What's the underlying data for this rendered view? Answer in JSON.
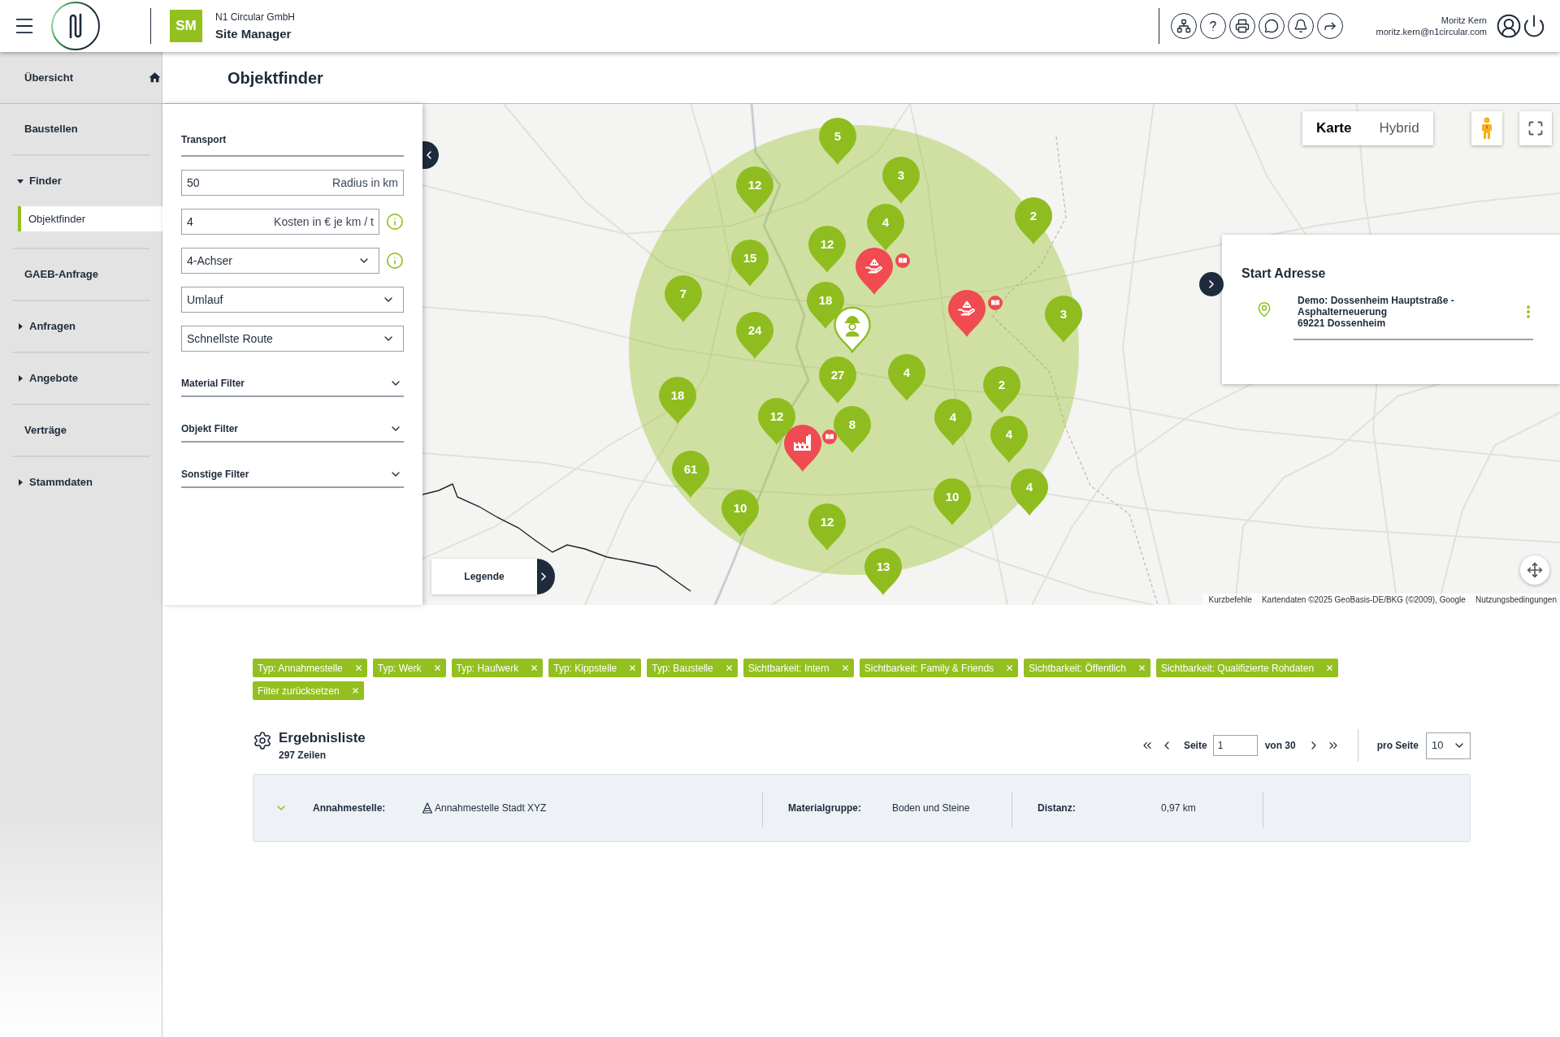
{
  "header": {
    "company": "N1 Circular GmbH",
    "app_name": "Site Manager",
    "app_initials": "SM",
    "user_name": "Moritz Kern",
    "user_email": "moritz.kern@n1circular.com"
  },
  "page_title": "Objektfinder",
  "sidebar": {
    "items": [
      {
        "kind": "home",
        "label": "Übersicht",
        "selected": false
      },
      {
        "kind": "link",
        "label": "Baustellen",
        "selected": false
      },
      {
        "kind": "group",
        "label": "Finder",
        "selected": false,
        "expanded": true,
        "children": [
          {
            "label": "Objektfinder",
            "selected": true
          }
        ]
      },
      {
        "kind": "link",
        "label": "GAEB-Anfrage",
        "selected": false
      },
      {
        "kind": "group",
        "label": "Anfragen",
        "selected": false,
        "expanded": false
      },
      {
        "kind": "group",
        "label": "Angebote",
        "selected": false,
        "expanded": false
      },
      {
        "kind": "link",
        "label": "Verträge",
        "selected": false
      },
      {
        "kind": "group",
        "label": "Stammdaten",
        "selected": false,
        "expanded": false
      }
    ]
  },
  "filters": {
    "section_title": "Transport",
    "fields": [
      {
        "kind": "input",
        "value": "50",
        "label": "Radius in km",
        "info": false
      },
      {
        "kind": "input",
        "value": "4",
        "label": "Kosten in € je km / t",
        "info": true
      },
      {
        "kind": "select",
        "value": "4-Achser",
        "info": true
      },
      {
        "kind": "select",
        "value": "Umlauf",
        "info": false
      },
      {
        "kind": "select",
        "value": "Schnellste Route",
        "info": false
      }
    ],
    "accordions": [
      {
        "label": "Material Filter",
        "expanded": false
      },
      {
        "label": "Objekt Filter",
        "expanded": false
      },
      {
        "label": "Sonstige Filter",
        "expanded": false
      }
    ]
  },
  "map": {
    "map_types": [
      {
        "label": "Karte",
        "selected": true
      },
      {
        "label": "Hybrid",
        "selected": false
      }
    ],
    "markers": [
      {
        "kind": "cluster",
        "label": "5"
      },
      {
        "kind": "cluster",
        "label": "3"
      },
      {
        "kind": "cluster",
        "label": "12"
      },
      {
        "kind": "cluster",
        "label": "2"
      },
      {
        "kind": "cluster",
        "label": "4"
      },
      {
        "kind": "cluster",
        "label": "12"
      },
      {
        "kind": "hand"
      },
      {
        "kind": "cluster",
        "label": "15"
      },
      {
        "kind": "cluster",
        "label": "7"
      },
      {
        "kind": "cluster",
        "label": "18"
      },
      {
        "kind": "hand"
      },
      {
        "kind": "cluster",
        "label": "3"
      },
      {
        "kind": "start"
      },
      {
        "kind": "cluster",
        "label": "24"
      },
      {
        "kind": "cluster",
        "label": "4"
      },
      {
        "kind": "cluster",
        "label": "27"
      },
      {
        "kind": "cluster",
        "label": "2"
      },
      {
        "kind": "cluster",
        "label": "18"
      },
      {
        "kind": "cluster",
        "label": "12"
      },
      {
        "kind": "cluster",
        "label": "4"
      },
      {
        "kind": "cluster",
        "label": "8"
      },
      {
        "kind": "cluster",
        "label": "4"
      },
      {
        "kind": "factory"
      },
      {
        "kind": "cluster",
        "label": "61"
      },
      {
        "kind": "cluster",
        "label": "4"
      },
      {
        "kind": "cluster",
        "label": "10"
      },
      {
        "kind": "cluster",
        "label": "10"
      },
      {
        "kind": "cluster",
        "label": "12"
      },
      {
        "kind": "cluster",
        "label": "13"
      }
    ],
    "start_address": {
      "title": "Start Adresse",
      "name": "Demo: Dossenheim Hauptstraße - Asphalterneuerung",
      "city": "69221 Dossenheim"
    },
    "legend": "Legende",
    "shortcuts_link": "Kurzbefehle",
    "attribution": "Kartendaten ©2025 GeoBasis-DE/BKG (©2009), Google",
    "terms_link": "Nutzungsbedingungen"
  },
  "filter_chips": [
    "Typ: Annahmestelle",
    "Typ: Werk",
    "Typ: Haufwerk",
    "Typ: Kippstelle",
    "Typ: Baustelle",
    "Sichtbarkeit: Intern",
    "Sichtbarkeit: Family & Friends",
    "Sichtbarkeit: Öffentlich",
    "Sichtbarkeit: Qualifizierte Rohdaten"
  ],
  "reset_chip": "Filter zurücksetzen",
  "results": {
    "title": "Ergebnisliste",
    "count": "297 Zeilen",
    "pagination": {
      "page_label": "Seite",
      "page": "1",
      "total_label": "von 30",
      "per_page_label": "pro Seite",
      "per_page": "10"
    },
    "rows": [
      {
        "cells": [
          {
            "kind": "object",
            "label": "Annahmestelle:",
            "value": "Annahmestelle Stadt XYZ"
          },
          {
            "kind": "text",
            "label": "Materialgruppe:",
            "value": "Boden und Steine"
          },
          {
            "kind": "text",
            "label": "Distanz:",
            "value": "0,97 km"
          }
        ]
      }
    ]
  }
}
